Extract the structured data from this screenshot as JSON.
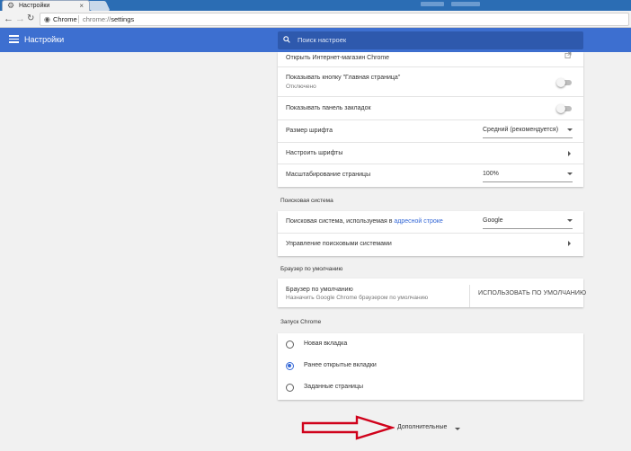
{
  "browser": {
    "tab_title": "Настройки",
    "tab_close": "×",
    "omnibox_site": "Chrome",
    "omnibox_url_scheme": "chrome://",
    "omnibox_url_path": "settings"
  },
  "header": {
    "title": "Настройки",
    "search_placeholder": "Поиск настроек"
  },
  "appearance": {
    "open_store": "Открыть Интернет-магазин Chrome",
    "home_button_label": "Показывать кнопку \"Главная страница\"",
    "home_button_status": "Отключено",
    "home_button_enabled": false,
    "bookmarks_bar_label": "Показывать панель закладок",
    "bookmarks_bar_enabled": false,
    "font_size_label": "Размер шрифта",
    "font_size_value": "Средний (рекомендуется)",
    "customize_fonts_label": "Настроить шрифты",
    "page_zoom_label": "Масштабирование страницы",
    "page_zoom_value": "100%"
  },
  "search_engine": {
    "section_title": "Поисковая система",
    "engine_label_prefix": "Поисковая система, используемая в",
    "engine_label_link": "адресной строке",
    "engine_value": "Google",
    "manage_label": "Управление поисковыми системами"
  },
  "default_browser": {
    "section_title": "Браузер по умолчанию",
    "label": "Браузер по умолчанию",
    "description": "Назначить Google Chrome браузером по умолчанию",
    "button_label": "ИСПОЛЬЗОВАТЬ ПО УМОЛЧАНИЮ"
  },
  "startup": {
    "section_title": "Запуск Chrome",
    "options": [
      {
        "label": "Новая вкладка",
        "selected": false
      },
      {
        "label": "Ранее открытые вкладки",
        "selected": true
      },
      {
        "label": "Заданные страницы",
        "selected": false
      }
    ]
  },
  "advanced": {
    "label": "Дополнительные"
  },
  "colors": {
    "header_blue": "#3d6fd0",
    "search_bg": "#2e59ad",
    "accent_blue": "#3367d6",
    "annotation_red": "#d0021b"
  },
  "icons": [
    "gear-icon",
    "back-icon",
    "forward-icon",
    "reload-icon",
    "info-icon",
    "menu-icon",
    "search-icon",
    "external-link-icon",
    "arrow-right-icon",
    "dropdown-caret-icon",
    "red-arrow-annotation"
  ]
}
